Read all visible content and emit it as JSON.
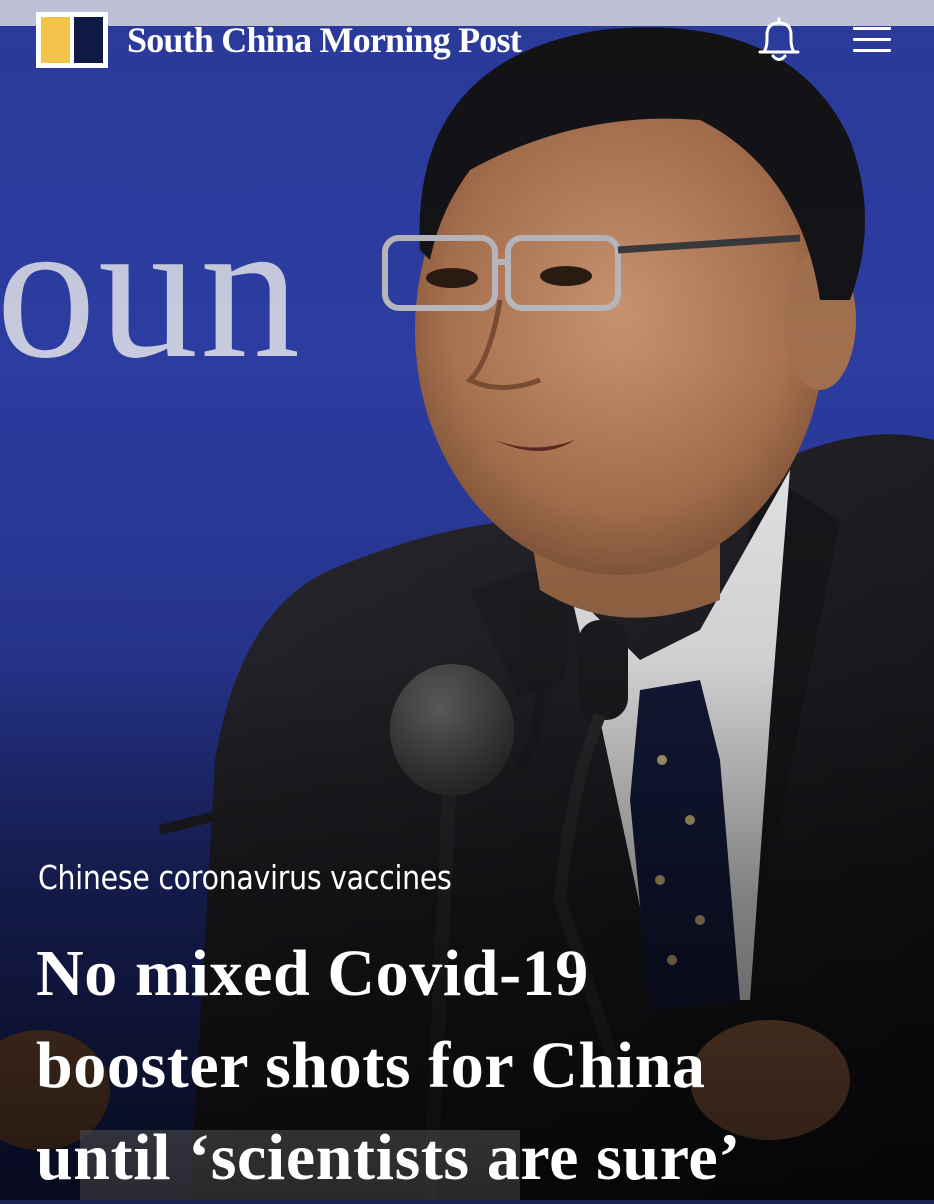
{
  "header": {
    "brand_name": "South China Morning Post",
    "logo_colors": {
      "yellow": "#f3c34a",
      "navy": "#0f1b44"
    },
    "notification_icon": "bell-icon",
    "menu_icon": "hamburger-menu-icon"
  },
  "hero": {
    "background_color": "#2a3a9c",
    "backdrop_text": "oun"
  },
  "article": {
    "topic": "Chinese coronavirus vaccines",
    "headline_lines": [
      "No mixed Covid-19",
      "booster shots for China",
      "until ‘scientists are sure’"
    ]
  }
}
